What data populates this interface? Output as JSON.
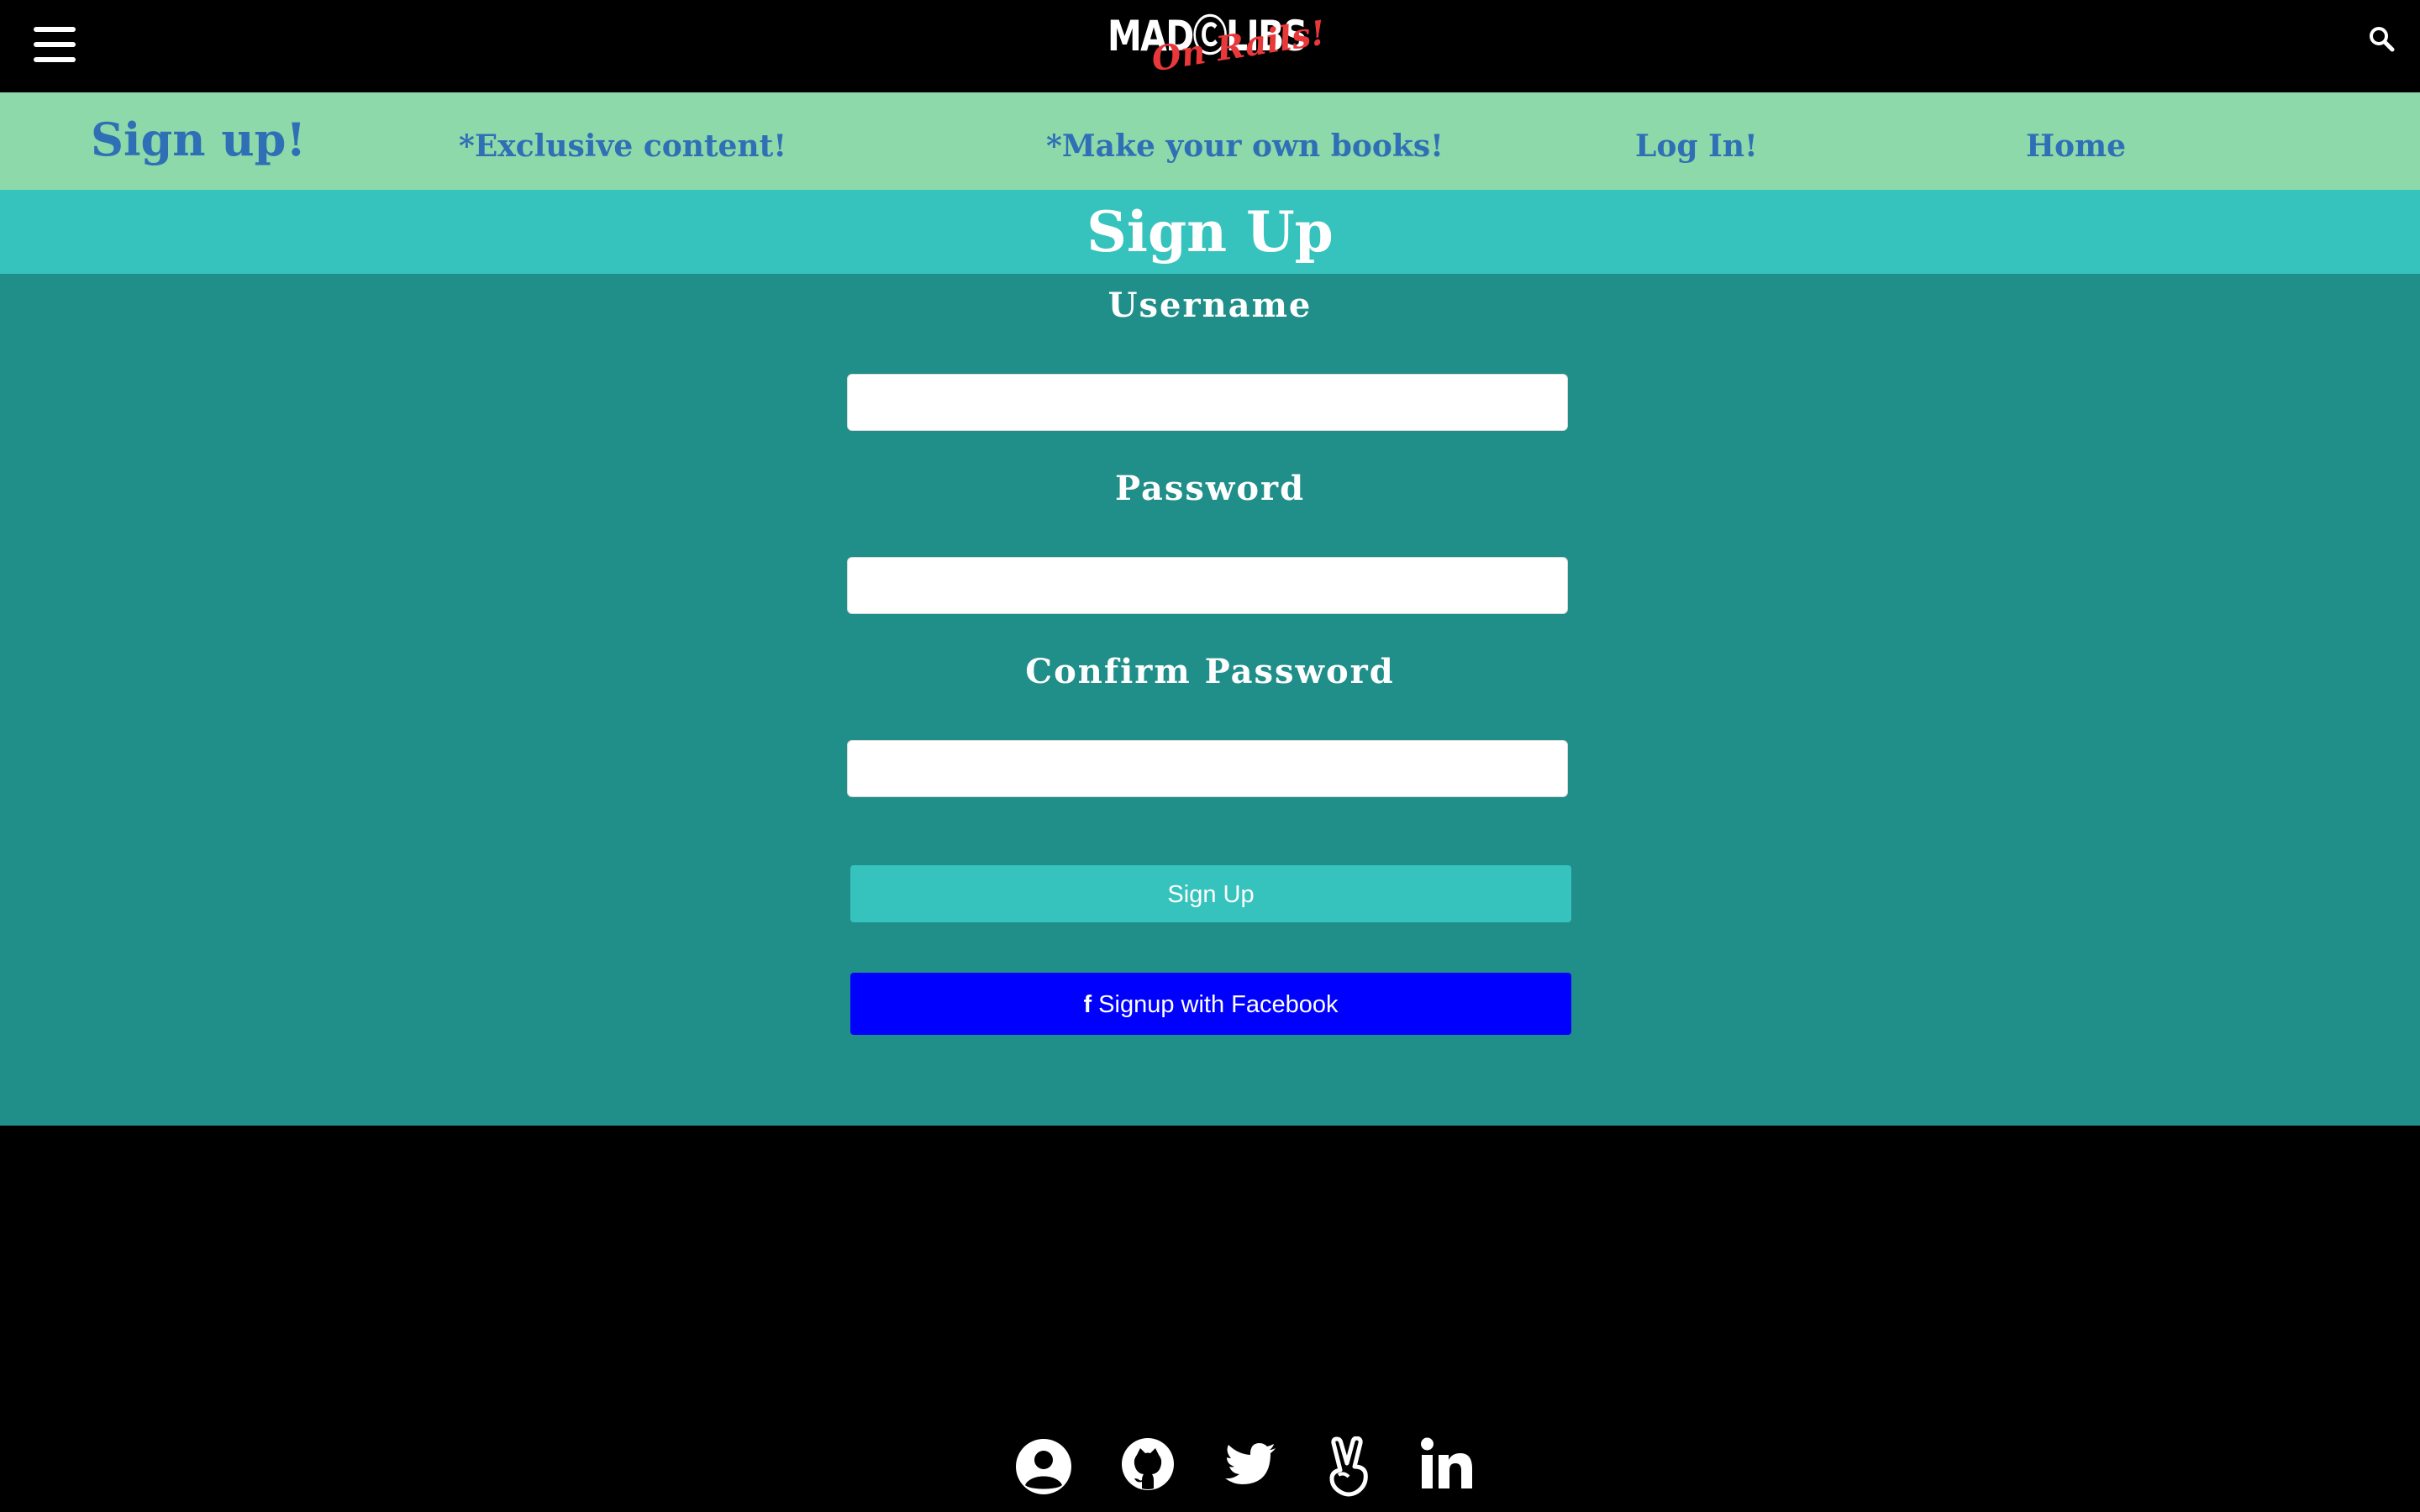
{
  "header": {
    "logo_main": "MADⒸLIBS",
    "logo_sub": "On Rails!",
    "menu_icon": "hamburger-menu-icon",
    "search_icon": "search-icon"
  },
  "nav": {
    "brand": "Sign up!",
    "items": [
      {
        "label": "*Exclusive content!"
      },
      {
        "label": "*Make your own books!"
      },
      {
        "label": "Log In!"
      },
      {
        "label": "Home"
      }
    ]
  },
  "page": {
    "title": "Sign Up"
  },
  "form": {
    "username_label": "Username",
    "username_value": "",
    "password_label": "Password",
    "password_value": "",
    "confirm_label": "Confirm Password",
    "confirm_value": "",
    "submit_label": "Sign Up",
    "facebook_label": "Signup with Facebook",
    "facebook_icon": "facebook-f-icon"
  },
  "footer": {
    "social": [
      {
        "icon": "user-circle-icon"
      },
      {
        "icon": "github-icon"
      },
      {
        "icon": "twitter-icon"
      },
      {
        "icon": "angellist-icon"
      },
      {
        "icon": "linkedin-icon"
      }
    ]
  },
  "colors": {
    "header_bg": "#000000",
    "nav_bg": "#8dd9aa",
    "nav_text": "#2f6fb6",
    "title_bg": "#36c3bd",
    "form_bg": "#208e89",
    "signup_button": "#36c3bd",
    "facebook_button": "#0000ff",
    "logo_accent": "#e8383a"
  }
}
